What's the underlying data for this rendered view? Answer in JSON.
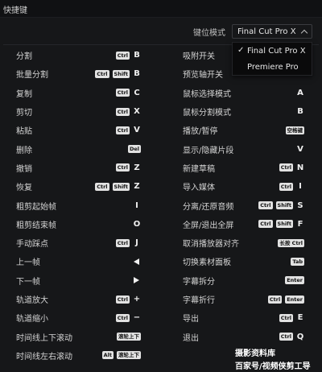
{
  "window": {
    "title": "快捷键"
  },
  "mode": {
    "label": "键位模式",
    "selected": "Final Cut Pro X",
    "options": [
      "Final Cut Pro X",
      "Premiere Pro"
    ]
  },
  "left_shortcuts": [
    {
      "label": "分割",
      "chips": [
        "Ctrl"
      ],
      "key": "B"
    },
    {
      "label": "批量分割",
      "chips": [
        "Ctrl",
        "Shift"
      ],
      "key": "B"
    },
    {
      "label": "复制",
      "chips": [
        "Ctrl"
      ],
      "key": "C"
    },
    {
      "label": "剪切",
      "chips": [
        "Ctrl"
      ],
      "key": "X"
    },
    {
      "label": "粘贴",
      "chips": [
        "Ctrl"
      ],
      "key": "V"
    },
    {
      "label": "删除",
      "chips": [
        "Del"
      ],
      "key": ""
    },
    {
      "label": "撤销",
      "chips": [
        "Ctrl"
      ],
      "key": "Z"
    },
    {
      "label": "恢复",
      "chips": [
        "Ctrl",
        "Shift"
      ],
      "key": "Z"
    },
    {
      "label": "粗剪起始帧",
      "chips": [],
      "key": "I"
    },
    {
      "label": "粗剪结束帧",
      "chips": [],
      "key": "O"
    },
    {
      "label": "手动踩点",
      "chips": [
        "Ctrl"
      ],
      "key": "J"
    },
    {
      "label": "上一帧",
      "chips": [],
      "key": "",
      "icon": "left-arrow-icon"
    },
    {
      "label": "下一帧",
      "chips": [],
      "key": "",
      "icon": "right-arrow-icon"
    },
    {
      "label": "轨道放大",
      "chips": [
        "Ctrl"
      ],
      "key": "+"
    },
    {
      "label": "轨道缩小",
      "chips": [
        "Ctrl"
      ],
      "key": "−"
    },
    {
      "label": "时间线上下滚动",
      "chips": [
        "滚轮上下"
      ],
      "key": ""
    },
    {
      "label": "时间线左右滚动",
      "chips": [
        "Alt",
        "滚轮上下"
      ],
      "key": ""
    }
  ],
  "right_shortcuts": [
    {
      "label": "吸附开关",
      "chips": [],
      "key": ""
    },
    {
      "label": "预览轴开关",
      "chips": [],
      "key": "S"
    },
    {
      "label": "鼠标选择模式",
      "chips": [],
      "key": "A"
    },
    {
      "label": "鼠标分割模式",
      "chips": [],
      "key": "B"
    },
    {
      "label": "播放/暂停",
      "chips": [
        "空格键"
      ],
      "key": ""
    },
    {
      "label": "显示/隐藏片段",
      "chips": [],
      "key": "V"
    },
    {
      "label": "新建草稿",
      "chips": [
        "Ctrl"
      ],
      "key": "N"
    },
    {
      "label": "导入媒体",
      "chips": [
        "Ctrl"
      ],
      "key": "I"
    },
    {
      "label": "分离/还原音频",
      "chips": [
        "Ctrl",
        "Shift"
      ],
      "key": "S"
    },
    {
      "label": "全屏/退出全屏",
      "chips": [
        "Ctrl",
        "Shift"
      ],
      "key": "F"
    },
    {
      "label": "取消播放器对齐",
      "chips": [
        "长按 Ctrl"
      ],
      "key": ""
    },
    {
      "label": "切换素材面板",
      "chips": [
        "Tab"
      ],
      "key": ""
    },
    {
      "label": "字幕拆分",
      "chips": [
        "Enter"
      ],
      "key": ""
    },
    {
      "label": "字幕折行",
      "chips": [
        "Ctrl",
        "Enter"
      ],
      "key": ""
    },
    {
      "label": "导出",
      "chips": [
        "Ctrl"
      ],
      "key": "E"
    },
    {
      "label": "退出",
      "chips": [
        "Ctrl"
      ],
      "key": "Q"
    }
  ],
  "watermark": {
    "line1": "摄影资料库",
    "line2": "百家号/视频侠剪工导"
  }
}
